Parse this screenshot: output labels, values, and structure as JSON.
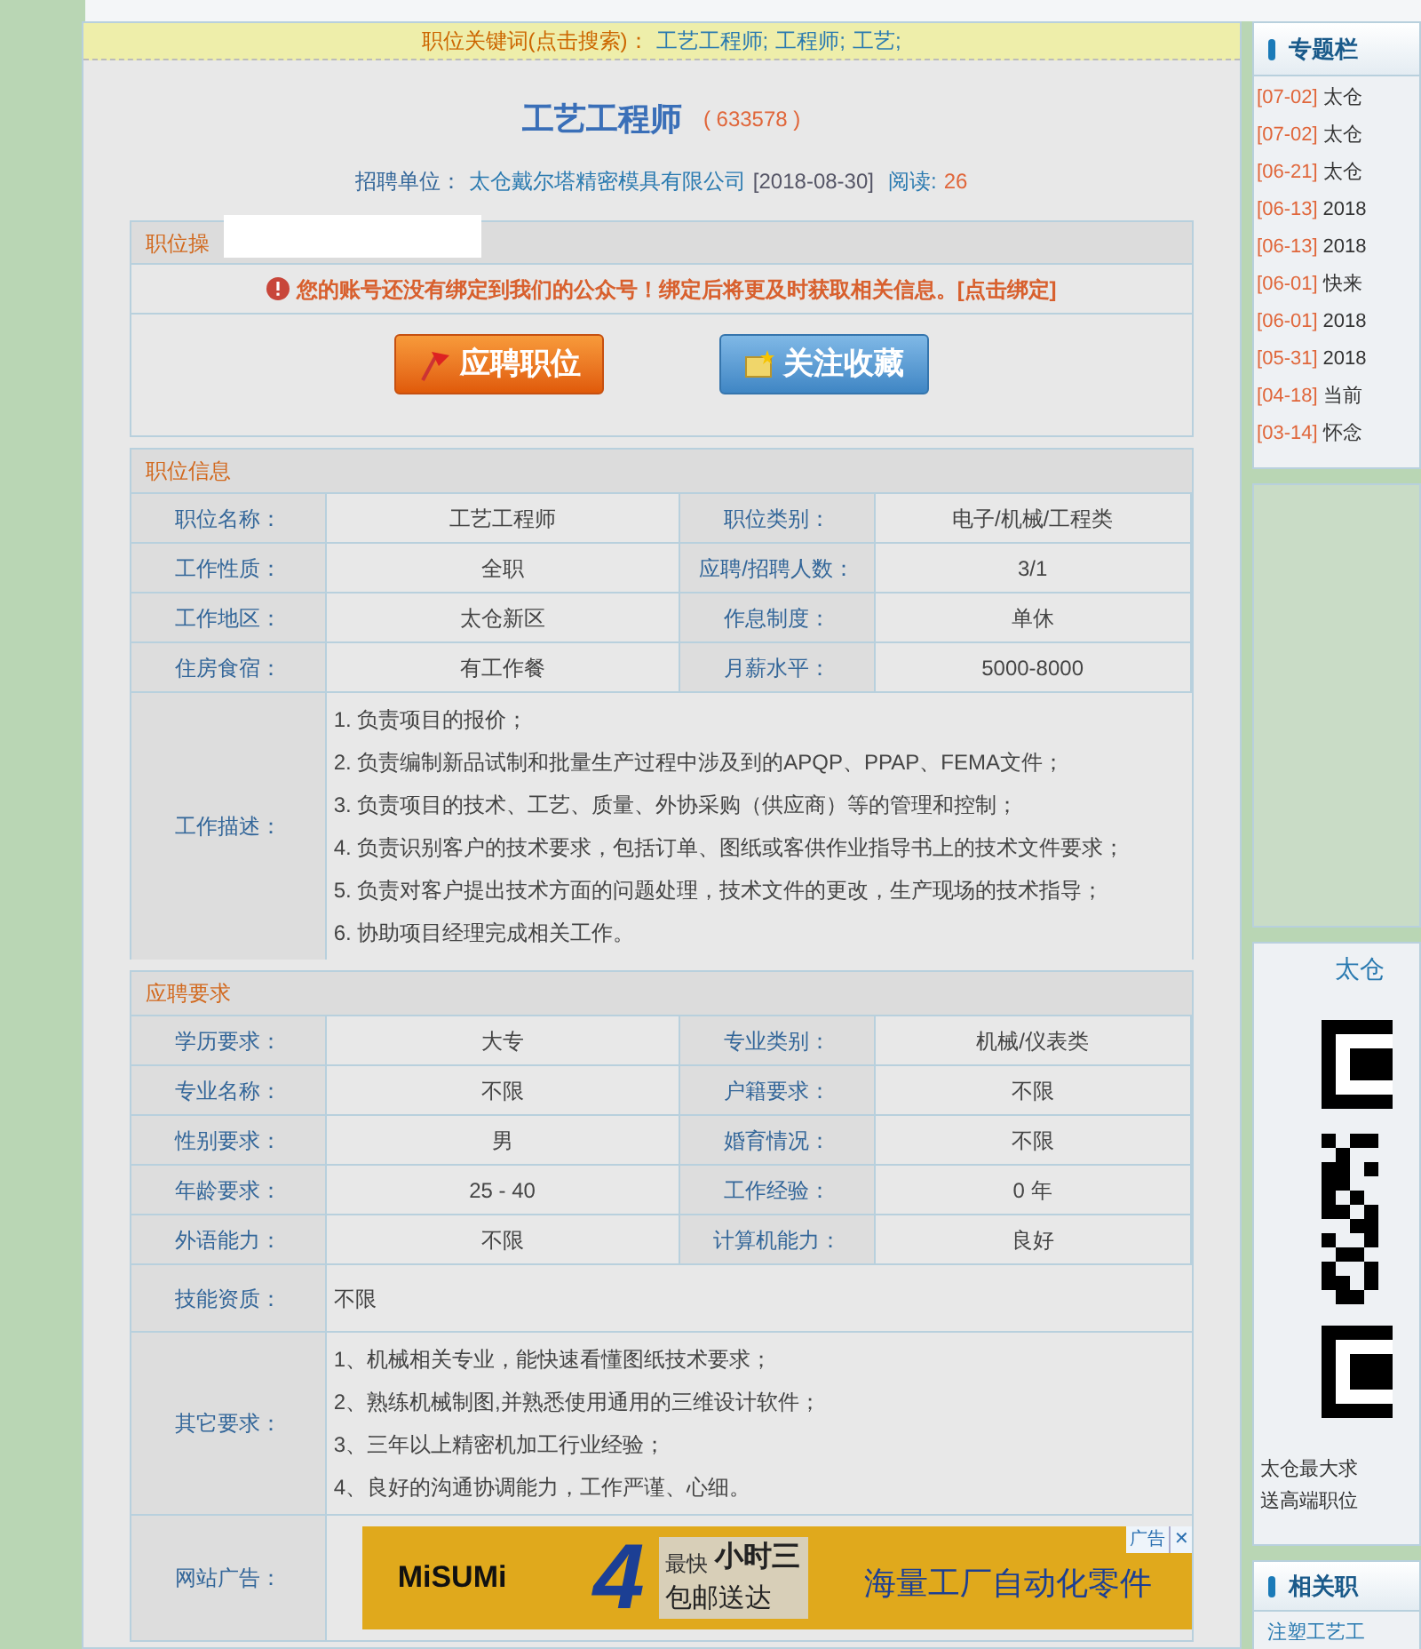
{
  "keywords": {
    "label": "职位关键词(点击搜索)：",
    "links": [
      "工艺工程师;",
      "工程师;",
      "工艺;"
    ]
  },
  "job": {
    "title": "工艺工程师",
    "id": "( 633578 )",
    "company_label": "招聘单位：",
    "company": "太仓戴尔塔精密模具有限公司",
    "date": "[2018-08-30]",
    "reads_label": "阅读:",
    "reads": "26"
  },
  "operations": {
    "header": "职位操",
    "notice": "您的账号还没有绑定到我们的公众号！绑定后将更及时获取相关信息。[点击绑定]",
    "buttons": [
      {
        "label": "应聘职位",
        "kind": "apply"
      },
      {
        "label": "关注收藏",
        "kind": "favorite"
      }
    ]
  },
  "sections": [
    {
      "header": "职位信息",
      "rows": [
        {
          "kind": "pair",
          "cells": [
            "职位名称：",
            "工艺工程师",
            "职位类别：",
            "电子/机械/工程类"
          ]
        },
        {
          "kind": "pair",
          "cells": [
            "工作性质：",
            "全职",
            "应聘/招聘人数：",
            "3/1"
          ]
        },
        {
          "kind": "pair",
          "cells": [
            "工作地区：",
            "太仓新区",
            "作息制度：",
            "单休"
          ]
        },
        {
          "kind": "pair",
          "cells": [
            "住房食宿：",
            "有工作餐",
            "月薪水平：",
            "5000-8000"
          ]
        },
        {
          "kind": "list",
          "label": "工作描述：",
          "lines": [
            "1. 负责项目的报价；",
            "2. 负责编制新品试制和批量生产过程中涉及到的APQP、PPAP、FEMA文件；",
            "3. 负责项目的技术、工艺、质量、外协采购（供应商）等的管理和控制；",
            "4. 负责识别客户的技术要求，包括订单、图纸或客供作业指导书上的技术文件要求；",
            "5. 负责对客户提出技术方面的问题处理，技术文件的更改，生产现场的技术指导；",
            "6. 协助项目经理完成相关工作。"
          ]
        }
      ]
    },
    {
      "header": "应聘要求",
      "rows": [
        {
          "kind": "pair",
          "cells": [
            "学历要求：",
            "大专",
            "专业类别：",
            "机械/仪表类"
          ]
        },
        {
          "kind": "pair",
          "cells": [
            "专业名称：",
            "不限",
            "户籍要求：",
            "不限"
          ]
        },
        {
          "kind": "pair",
          "cells": [
            "性别要求：",
            "男",
            "婚育情况：",
            "不限"
          ]
        },
        {
          "kind": "pair",
          "cells": [
            "年龄要求：",
            "25 - 40",
            "工作经验：",
            "0 年"
          ]
        },
        {
          "kind": "pair",
          "cells": [
            "外语能力：",
            "不限",
            "计算机能力：",
            "良好"
          ]
        },
        {
          "kind": "text",
          "label": "技能资质：",
          "lines": [
            "不限"
          ]
        },
        {
          "kind": "list",
          "label": "其它要求：",
          "lines": [
            "1、机械相关专业，能快速看懂图纸技术要求；",
            "2、熟练机械制图,并熟悉使用通用的三维设计软件；",
            "3、三年以上精密机加工行业经验；",
            "4、良好的沟通协调能力，工作严谨、心细。"
          ]
        },
        {
          "kind": "ad",
          "label": "网站广告：",
          "ad": {
            "brand": "MiSUMi",
            "big": "4",
            "small": "最快",
            "line1": "小时三",
            "line2": "包邮送达",
            "slogan": "海量工厂自动化零件",
            "tag": "广告",
            "close": "✕"
          }
        }
      ]
    }
  ],
  "sidebar": {
    "topics_header": "专题栏",
    "topics": [
      {
        "date": "[07-02]",
        "title": "太仓"
      },
      {
        "date": "[07-02]",
        "title": "太仓"
      },
      {
        "date": "[06-21]",
        "title": "太仓"
      },
      {
        "date": "[06-13]",
        "title": "2018"
      },
      {
        "date": "[06-13]",
        "title": "2018"
      },
      {
        "date": "[06-01]",
        "title": "快来"
      },
      {
        "date": "[06-01]",
        "title": "2018"
      },
      {
        "date": "[05-31]",
        "title": "2018"
      },
      {
        "date": "[04-18]",
        "title": "当前"
      },
      {
        "date": "[03-14]",
        "title": "怀念"
      }
    ],
    "qr_title": "太仓",
    "qr_lines": [
      "太仓最大求",
      "送高端职位"
    ],
    "related_header": "相关职",
    "related": [
      "注塑工艺工"
    ]
  }
}
